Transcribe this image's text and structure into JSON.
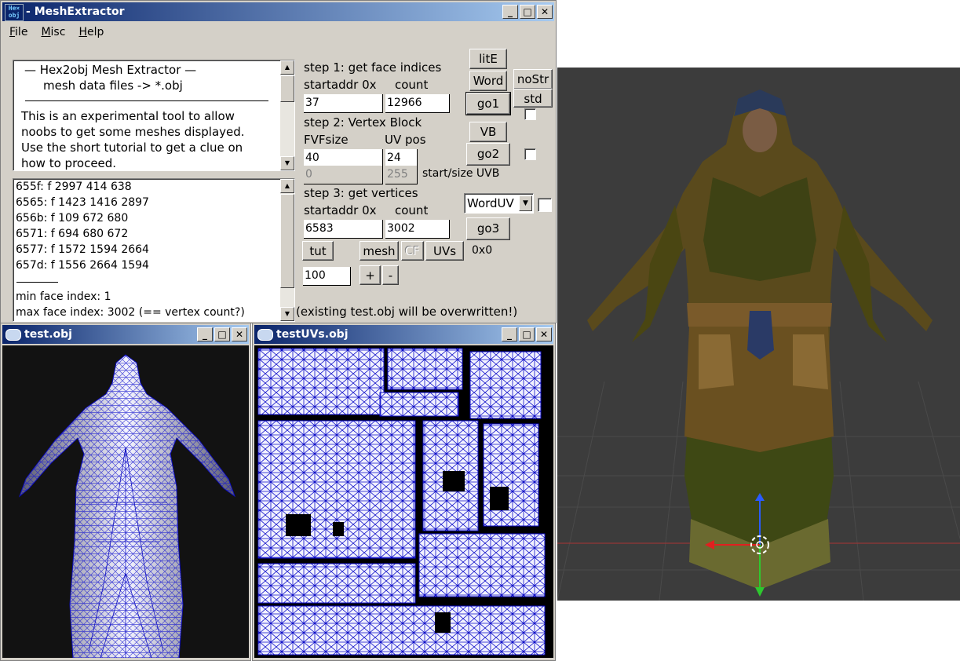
{
  "main_window": {
    "title": "MeshExtractor",
    "title_prefix": "- ",
    "icon_text_top": "He×",
    "icon_text_bottom": "obj",
    "menu": [
      "File",
      "Misc",
      "Help"
    ]
  },
  "info_box": {
    "heading1": "—   Hex2obj Mesh Extractor   —",
    "heading2": "mesh data files -> *.obj",
    "body": [
      "This is an experimental tool to allow",
      "noobs to get some meshes displayed.",
      "Use the short tutorial to get a clue on",
      "how to proceed."
    ]
  },
  "log_box": {
    "lines": [
      "655f: f  2997 414 638",
      "6565: f  1423 1416 2897",
      "656b: f  109 672 680",
      "6571: f  694 680 672",
      "6577: f  1572 1594 2664",
      "657d: f  1556 2664 1594"
    ],
    "min_text": "min face index: 1",
    "max_text": "max face index: 3002 (== vertex count?)"
  },
  "step1": {
    "title": "step 1: get face indices",
    "startaddr_label": "startaddr 0x",
    "count_label": "count",
    "startaddr": "37",
    "count": "12966"
  },
  "step2": {
    "title": "step 2: Vertex Block",
    "fvf_label": "FVFsize",
    "uvpos_label": "UV pos",
    "fvf": "40",
    "uvpos": "24",
    "uvb_start": "0",
    "uvb_size": "255",
    "uvb_label": "start/size UVB"
  },
  "step3": {
    "title": "step 3: get vertices",
    "startaddr_label": "startaddr 0x",
    "count_label": "count",
    "startaddr": "6583",
    "count": "3002"
  },
  "buttons": {
    "lite": "litE",
    "word": "Word",
    "nostr": "noStr",
    "go1": "go1",
    "std": "std",
    "vb": "VB",
    "go2": "go2",
    "go3": "go3",
    "tut": "tut",
    "mesh": "mesh",
    "cf": "CF",
    "uvs": "UVs",
    "plus": "+",
    "minus": "-"
  },
  "wordfmt_select": "WordUV",
  "hex_readout": "0x0",
  "zoom_value": "100",
  "warning": "(existing test.obj will be overwritten!)",
  "mesh_window": {
    "title": "test.obj"
  },
  "uv_window": {
    "title": "testUVs.obj"
  },
  "colors": {
    "title_active": "#0a246a",
    "wire": "#0000cc",
    "viewport": "#3c3c3c"
  }
}
